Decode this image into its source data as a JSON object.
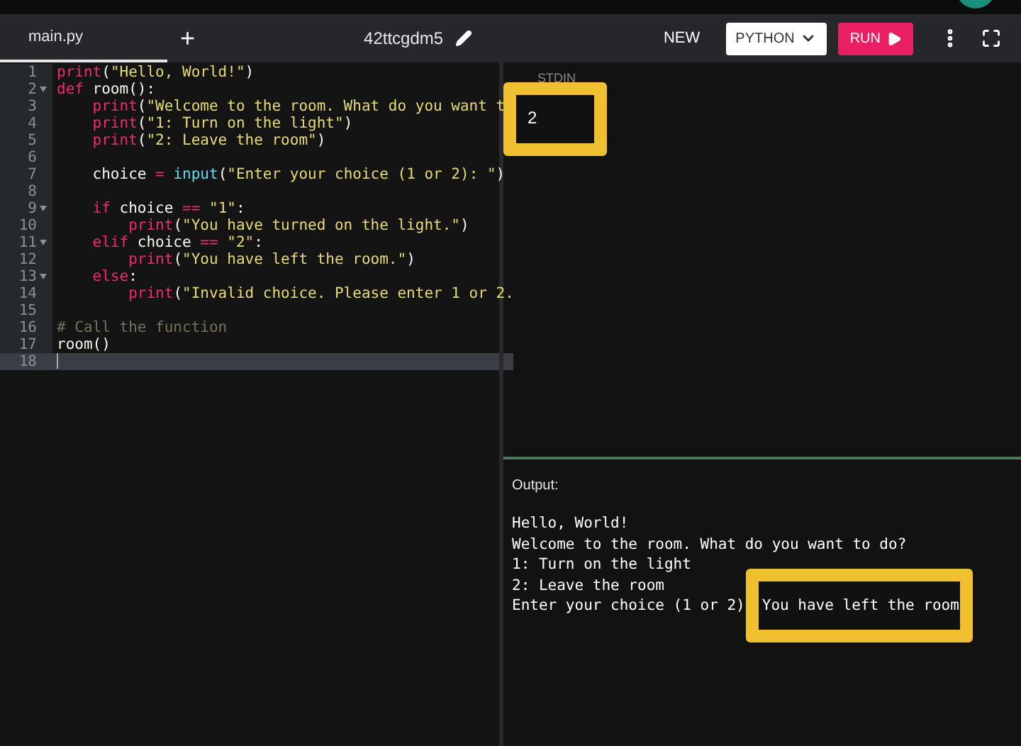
{
  "tab": {
    "label": "main.py",
    "selected": true
  },
  "add_tab": "+",
  "project_name": "42ttcgdm5",
  "toolbar": {
    "new": "NEW",
    "language": "PYTHON",
    "run": "RUN"
  },
  "code_lines": [
    {
      "number": "1",
      "fold": false,
      "active": false,
      "tokens": [
        {
          "kind": "fn",
          "text": "print"
        },
        {
          "kind": "plain",
          "text": "("
        },
        {
          "kind": "string",
          "text": "\"Hello, World!\""
        },
        {
          "kind": "plain",
          "text": ")"
        }
      ]
    },
    {
      "number": "2",
      "fold": true,
      "active": false,
      "tokens": [
        {
          "kind": "keyword",
          "text": "def"
        },
        {
          "kind": "plain",
          "text": " room():"
        }
      ]
    },
    {
      "number": "3",
      "fold": false,
      "active": false,
      "tokens": [
        {
          "kind": "fn",
          "text": "    print"
        },
        {
          "kind": "plain",
          "text": "("
        },
        {
          "kind": "string",
          "text": "\"Welcome to the room. What do you want t"
        }
      ]
    },
    {
      "number": "4",
      "fold": false,
      "active": false,
      "tokens": [
        {
          "kind": "fn",
          "text": "    print"
        },
        {
          "kind": "plain",
          "text": "("
        },
        {
          "kind": "string",
          "text": "\"1: Turn on the light\""
        },
        {
          "kind": "plain",
          "text": ")"
        }
      ]
    },
    {
      "number": "5",
      "fold": false,
      "active": false,
      "tokens": [
        {
          "kind": "fn",
          "text": "    print"
        },
        {
          "kind": "plain",
          "text": "("
        },
        {
          "kind": "string",
          "text": "\"2: Leave the room\""
        },
        {
          "kind": "plain",
          "text": ")"
        }
      ]
    },
    {
      "number": "6",
      "fold": false,
      "active": false
    },
    {
      "number": "7",
      "fold": false,
      "active": false,
      "tokens": [
        {
          "kind": "plain",
          "text": "    choice "
        },
        {
          "kind": "keyword",
          "text": "="
        },
        {
          "kind": "builtin",
          "text": " input"
        },
        {
          "kind": "plain",
          "text": "("
        },
        {
          "kind": "string",
          "text": "\"Enter your choice (1 or 2): \""
        },
        {
          "kind": "plain",
          "text": ")"
        }
      ]
    },
    {
      "number": "8",
      "fold": false,
      "active": false
    },
    {
      "number": "9",
      "fold": true,
      "active": false,
      "tokens": [
        {
          "kind": "keyword",
          "text": "    if"
        },
        {
          "kind": "plain",
          "text": " choice "
        },
        {
          "kind": "keyword",
          "text": "=="
        },
        {
          "kind": "string",
          "text": " \"1\""
        },
        {
          "kind": "plain",
          "text": ":"
        }
      ]
    },
    {
      "number": "10",
      "fold": false,
      "active": false,
      "tokens": [
        {
          "kind": "fn",
          "text": "        print"
        },
        {
          "kind": "plain",
          "text": "("
        },
        {
          "kind": "string",
          "text": "\"You have turned on the light.\""
        },
        {
          "kind": "plain",
          "text": ")"
        }
      ]
    },
    {
      "number": "11",
      "fold": true,
      "active": false,
      "tokens": [
        {
          "kind": "keyword",
          "text": "    elif"
        },
        {
          "kind": "plain",
          "text": " choice "
        },
        {
          "kind": "keyword",
          "text": "=="
        },
        {
          "kind": "string",
          "text": " \"2\""
        },
        {
          "kind": "plain",
          "text": ":"
        }
      ]
    },
    {
      "number": "12",
      "fold": false,
      "active": false,
      "tokens": [
        {
          "kind": "fn",
          "text": "        print"
        },
        {
          "kind": "plain",
          "text": "("
        },
        {
          "kind": "string",
          "text": "\"You have left the room.\""
        },
        {
          "kind": "plain",
          "text": ")"
        }
      ]
    },
    {
      "number": "13",
      "fold": true,
      "active": false,
      "tokens": [
        {
          "kind": "keyword",
          "text": "    else"
        },
        {
          "kind": "plain",
          "text": ":"
        }
      ]
    },
    {
      "number": "14",
      "fold": false,
      "active": false,
      "tokens": [
        {
          "kind": "fn",
          "text": "        print"
        },
        {
          "kind": "plain",
          "text": "("
        },
        {
          "kind": "string",
          "text": "\"Invalid choice. Please enter 1 or 2."
        }
      ]
    },
    {
      "number": "15",
      "fold": false,
      "active": false
    },
    {
      "number": "16",
      "fold": false,
      "active": false,
      "tokens": [
        {
          "kind": "comment",
          "text": "# Call the function"
        }
      ]
    },
    {
      "number": "17",
      "fold": false,
      "active": false,
      "tokens": [
        {
          "kind": "plain",
          "text": "room()"
        }
      ]
    },
    {
      "number": "18",
      "fold": false,
      "active": true
    }
  ],
  "stdin": {
    "label": "STDIN",
    "value": "2"
  },
  "output": {
    "label": "Output:",
    "lines": [
      "Hello, World!",
      "Welcome to the room. What do you want to do?",
      "1: Turn on the light",
      "2: Leave the room"
    ],
    "last_line": {
      "prompt": "Enter your choice (1 or 2)",
      "response": "You have left the room"
    }
  }
}
